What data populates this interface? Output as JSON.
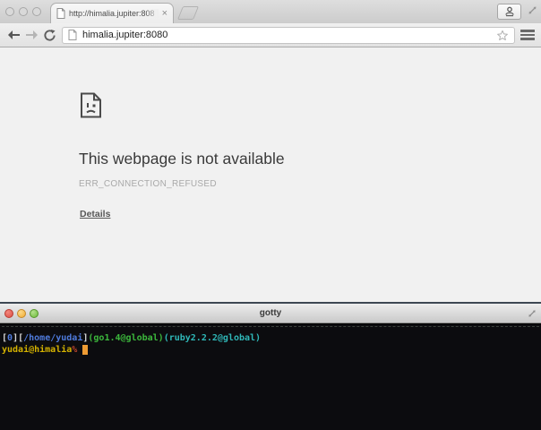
{
  "browser": {
    "tab_strip": {
      "tab_title": "http://himalia.jupiter:808",
      "tab_close": "×"
    },
    "toolbar": {
      "url": "himalia.jupiter:8080"
    },
    "error_page": {
      "heading": "This webpage is not available",
      "error_code": "ERR_CONNECTION_REFUSED",
      "details_label": "Details"
    }
  },
  "terminal": {
    "title": "gotty",
    "prompt_line1": {
      "bracket_open1": "[",
      "jobs": "0",
      "bracket_close1": "]",
      "bracket_open2": "[",
      "cwd": "/home/yudai",
      "bracket_close2": "]",
      "go_env": "(go1.4@global)",
      "ruby_env": "(ruby2.2.2@global)"
    },
    "prompt_line2": {
      "user_host": "yudai@himalia",
      "prompt_symbol": "%"
    }
  },
  "colors": {
    "terminal_bg": "#0c0c0f",
    "terminal_bracket": "#d8d8d8",
    "terminal_blue": "#4f7bdc",
    "terminal_green": "#3cb83c",
    "terminal_cyan": "#2fb8b8",
    "terminal_yellow": "#d4b200",
    "terminal_red": "#b9442c",
    "cursor_orange": "#ef9b33",
    "error_heading": "#3a3a3a",
    "error_code_gray": "#a9a9a9"
  }
}
